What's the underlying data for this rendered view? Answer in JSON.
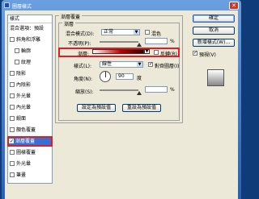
{
  "window": {
    "title": "圖層樣式",
    "close_glyph": "✕"
  },
  "styles": {
    "header": "樣式",
    "items": [
      {
        "label": "混合選項：預設",
        "checkbox": false,
        "indent": false
      },
      {
        "label": "斜角和浮雕",
        "checkbox": true,
        "indent": false
      },
      {
        "label": "輪廓",
        "checkbox": true,
        "indent": true
      },
      {
        "label": "紋理",
        "checkbox": true,
        "indent": true
      },
      {
        "label": "陰影",
        "checkbox": true,
        "indent": false
      },
      {
        "label": "內陰影",
        "checkbox": true,
        "indent": false
      },
      {
        "label": "外光暈",
        "checkbox": true,
        "indent": false
      },
      {
        "label": "內光暈",
        "checkbox": true,
        "indent": false
      },
      {
        "label": "緞面",
        "checkbox": true,
        "indent": false
      },
      {
        "label": "顏色覆蓋",
        "checkbox": true,
        "indent": false
      },
      {
        "label": "漸層覆蓋",
        "checkbox": true,
        "indent": false,
        "selected": true,
        "checked": true
      },
      {
        "label": "圖樣覆蓋",
        "checkbox": true,
        "indent": false
      },
      {
        "label": "外光暈",
        "checkbox": true,
        "indent": false
      },
      {
        "label": "筆畫",
        "checkbox": true,
        "indent": false
      }
    ]
  },
  "gradient_overlay": {
    "group_title": "漸層覆蓋",
    "subgroup_title": "漸層",
    "blend_mode_label": "混合模式(D):",
    "blend_mode_value": "正常",
    "dither_label": "混色",
    "opacity_label": "不透明(P):",
    "opacity_unit": "%",
    "opacity_percent": 100,
    "gradient_label": "漸層:",
    "reverse_label": "反轉(R)",
    "style_label": "樣式(L):",
    "style_value": "線性",
    "align_label": "對齊圖層(I)",
    "angle_label": "角度(N):",
    "angle_value": "90",
    "angle_unit": "度",
    "scale_label": "縮放(S):",
    "scale_unit": "%",
    "scale_percent": 100,
    "make_default_button": "設定為預設值",
    "reset_default_button": "重設為預設值"
  },
  "actions": {
    "ok": "確定",
    "cancel": "取消",
    "new_style": "新增樣式(W)...",
    "preview_label": "預視(V)"
  },
  "colors": {
    "selection": "#3a6ed0",
    "highlight": "#e51c23"
  }
}
